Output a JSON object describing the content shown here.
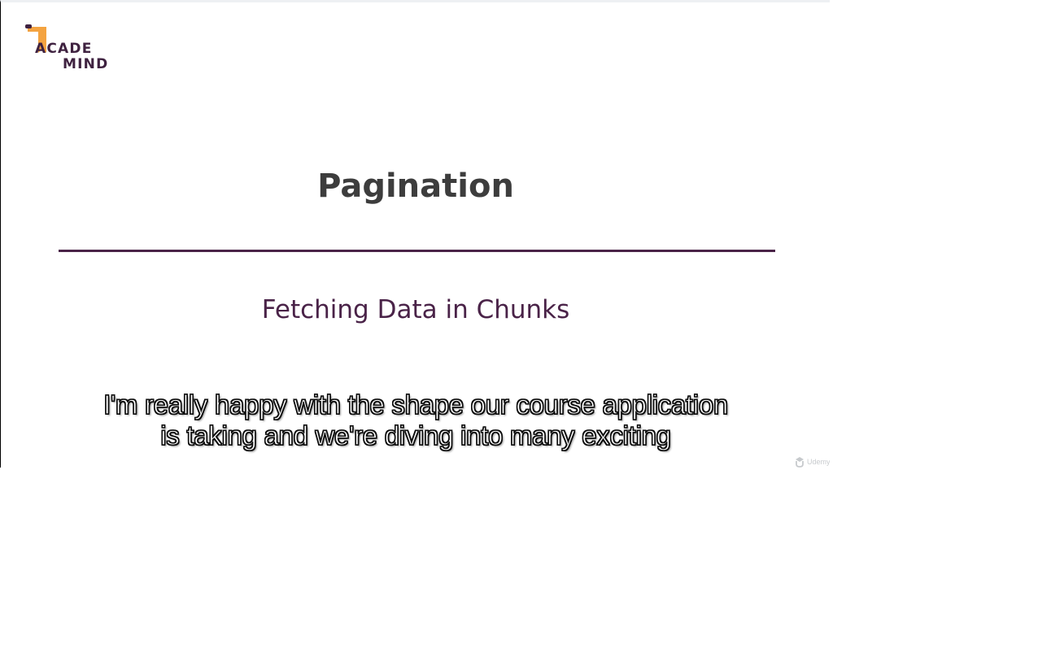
{
  "logo": {
    "line1": "ACADE",
    "line2": "MIND",
    "bookmark_color": "#f4a340"
  },
  "slide": {
    "title": "Pagination",
    "subtitle": "Fetching Data in Chunks",
    "divider_color": "#4a2348"
  },
  "captions": {
    "line1": "I'm really happy with the shape our course application",
    "line2": "is taking and we're diving into many exciting"
  },
  "watermark": {
    "icon": "udemy-logo-icon",
    "text": "Udemy"
  }
}
